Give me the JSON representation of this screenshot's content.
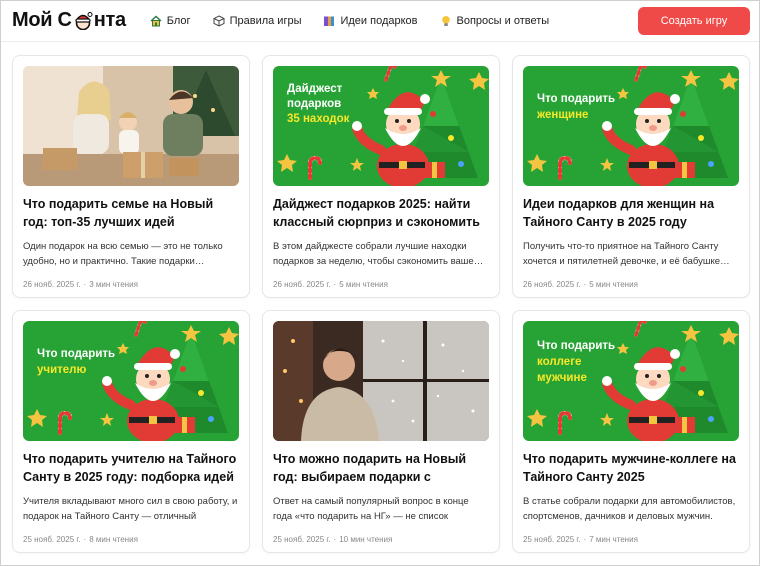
{
  "header": {
    "logo_prefix": "Мой С",
    "logo_suffix": "нта",
    "nav": [
      {
        "label": "Блог",
        "icon": "home-icon"
      },
      {
        "label": "Правила игры",
        "icon": "cube-icon"
      },
      {
        "label": "Идеи подарков",
        "icon": "book-icon"
      },
      {
        "label": "Вопросы и ответы",
        "icon": "lightbulb-icon"
      }
    ],
    "cta_label": "Создать игру"
  },
  "colors": {
    "accent": "#f04a48",
    "banner_green": "#27a234",
    "banner_yellow": "#f6e82a"
  },
  "articles": [
    {
      "image": "family-photo",
      "title": "Что подарить семье на Новый год: топ-35 лучших идей",
      "desc": "Один подарок на всю семью — это не только удобно, но и практично. Такие подарки…",
      "date": "26 нояб. 2025 г.",
      "read": "3 мин чтения"
    },
    {
      "image": "santa-banner",
      "banner_line1": "Дайджест",
      "banner_line2": "подарков",
      "banner_highlight": "35 находок",
      "title": "Дайджест подарков 2025: найти классный сюрприз и сэкономить",
      "desc": "В этом дайджесте собрали лучшие находки подарков за неделю, чтобы сэкономить ваше…",
      "date": "26 нояб. 2025 г.",
      "read": "5 мин чтения"
    },
    {
      "image": "santa-banner",
      "banner_line1": "Что подарить",
      "banner_line2": "",
      "banner_highlight": "женщине",
      "title": "Идеи подарков для женщин на Тайного Санту в 2025 году",
      "desc": "Получить что-то приятное на Тайного Санту хочется и пятилетней девочке, и её бабушке…",
      "date": "26 нояб. 2025 г.",
      "read": "5 мин чтения"
    },
    {
      "image": "santa-banner",
      "banner_line1": "Что подарить",
      "banner_line2": "",
      "banner_highlight": "учителю",
      "title": "Что подарить учителю на Тайного Санту в 2025 году: подборка идей",
      "desc": "Учителя вкладывают много сил в свою работу, и подарок на Тайного Санту — отличный способ…",
      "date": "25 нояб. 2025 г.",
      "read": "8 мин чтения"
    },
    {
      "image": "window-photo",
      "title": "Что можно подарить на Новый год: выбираем подарки с эмпатией",
      "desc": "Ответ на самый популярный вопрос в конце года «что подарить на НГ» — не список покупок,…",
      "date": "25 нояб. 2025 г.",
      "read": "10 мин чтения"
    },
    {
      "image": "santa-banner",
      "banner_line1": "Что подарить",
      "banner_line2": "",
      "banner_highlight": "коллеге",
      "banner_highlight2": "мужчине",
      "title": "Что подарить мужчине-коллеге на Тайного Санту 2025",
      "desc": "В статье собрали подарки для автомобилистов, спортсменов, дачников и деловых мужчин. Если…",
      "date": "25 нояб. 2025 г.",
      "read": "7 мин чтения"
    }
  ]
}
